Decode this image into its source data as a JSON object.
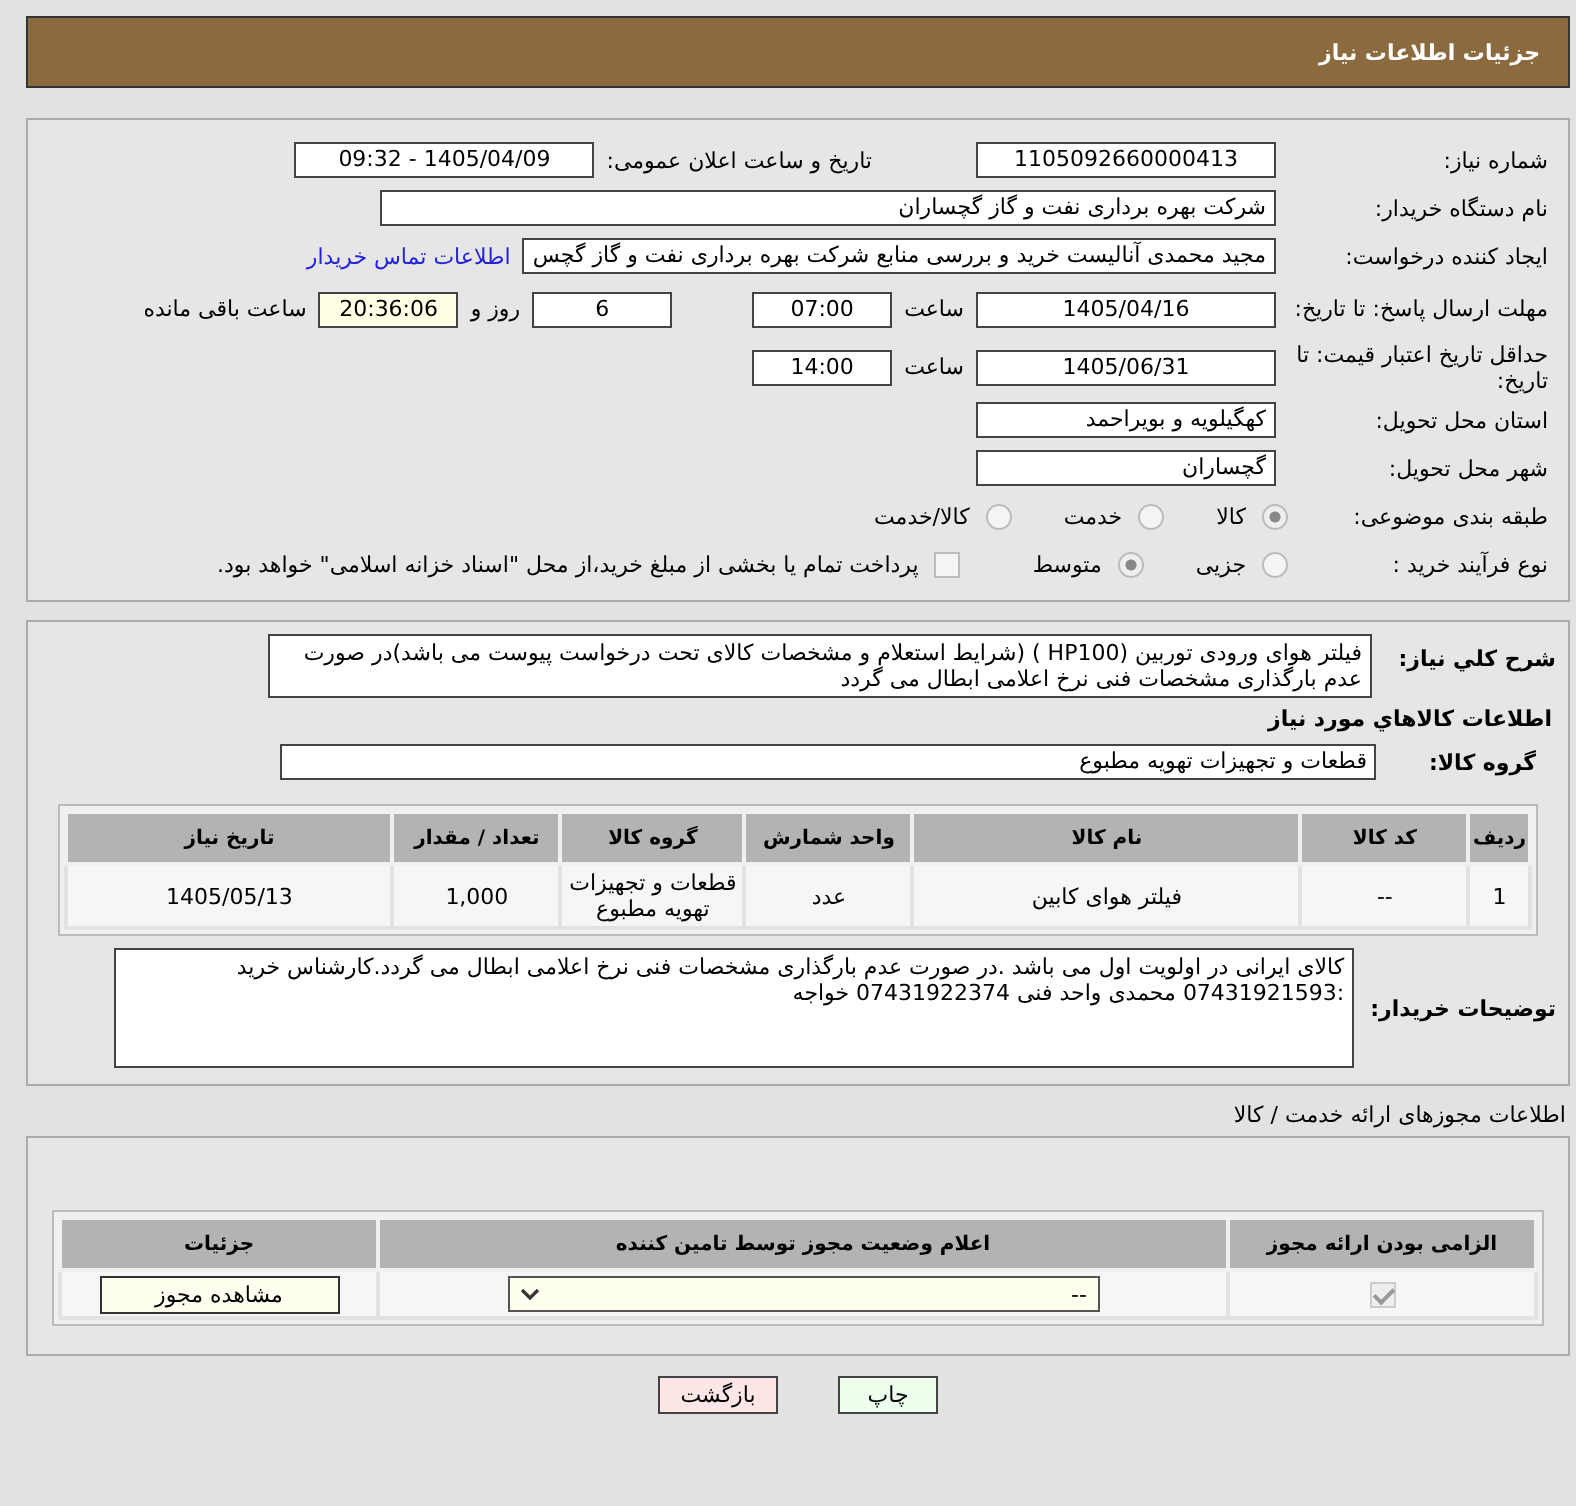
{
  "page_title": "جزئیات اطلاعات نیاز",
  "need_number": {
    "label": "شماره نیاز:",
    "value": "1105092660000413"
  },
  "announce": {
    "label": "تاریخ و ساعت اعلان عمومی:",
    "value": "1405/04/09 - 09:32"
  },
  "buyer_org": {
    "label": "نام دستگاه خریدار:",
    "value": "شرکت بهره برداری نفت و گاز گچساران"
  },
  "creator": {
    "label": "ایجاد کننده درخواست:",
    "value": "مجید محمدی آنالیست خرید و بررسی منابع شرکت بهره برداری نفت و گاز گچس",
    "link": "اطلاعات تماس خریدار"
  },
  "deadline": {
    "label": "مهلت ارسال پاسخ: تا تاریخ:",
    "date": "1405/04/16",
    "time_label": "ساعت",
    "time": "07:00",
    "days": "6",
    "days_label": "روز و",
    "remaining": "20:36:06",
    "remaining_label": "ساعت باقی مانده"
  },
  "validity": {
    "label": "حداقل تاریخ اعتبار قیمت: تا تاریخ:",
    "date": "1405/06/31",
    "time_label": "ساعت",
    "time": "14:00"
  },
  "province": {
    "label": "استان محل تحویل:",
    "value": "کهگیلویه و بویراحمد"
  },
  "city": {
    "label": "شهر محل تحویل:",
    "value": "گچساران"
  },
  "category": {
    "label": "طبقه بندی موضوعی:",
    "options": [
      {
        "label": "کالا",
        "selected": true
      },
      {
        "label": "خدمت",
        "selected": false
      },
      {
        "label": "کالا/خدمت",
        "selected": false
      }
    ]
  },
  "process": {
    "label": "نوع فرآیند خرید :",
    "options": [
      {
        "label": "جزیی",
        "selected": false
      },
      {
        "label": "متوسط",
        "selected": true
      }
    ],
    "payment": {
      "label": "پرداخت تمام یا بخشی از مبلغ خرید،از محل \"اسناد خزانه اسلامی\" خواهد بود.",
      "checked": false
    }
  },
  "description": {
    "label": "شرح کلي نياز:",
    "value": "فیلتر هوای ورودی توربین (HP100 ) (شرایط استعلام و مشخصات کالای تحت درخواست پیوست می باشد)در صورت عدم بارگذاری مشخصات فنی نرخ اعلامی ابطال می گردد"
  },
  "goods_title": "اطلاعات کالاهاي مورد نياز",
  "goods_group": {
    "label": "گروه کالا:",
    "value": "قطعات و تجهیزات تهویه مطبوع"
  },
  "goods_table": {
    "columns": [
      "ردیف",
      "کد کالا",
      "نام کالا",
      "واحد شمارش",
      "گروه کالا",
      "تعداد / مقدار",
      "تاریخ نیاز"
    ],
    "rows": [
      [
        "1",
        "--",
        "فیلتر هوای کابین",
        "عدد",
        "قطعات و تجهیزات تهویه مطبوع",
        "1,000",
        "1405/05/13"
      ]
    ]
  },
  "buyer_notes": {
    "label": "توضیحات خریدار:",
    "value": "کالای ایرانی در اولویت اول می باشد .در صورت عدم بارگذاری مشخصات فنی نرخ اعلامی ابطال می گردد.کارشناس خرید :07431921593 محمدی واحد فنی 07431922374  خواجه"
  },
  "license_title": "اطلاعات مجوزهای ارائه خدمت / کالا",
  "license_table": {
    "columns": [
      "الزامی بودن ارائه مجوز",
      "اعلام وضعیت مجوز توسط تامین کننده",
      "جزئیات"
    ],
    "rows": [
      {
        "required": true,
        "status": "--",
        "action": "مشاهده مجوز"
      }
    ]
  },
  "buttons": [
    {
      "label": "چاپ",
      "kind": "print"
    },
    {
      "label": "بازگشت",
      "kind": "back"
    }
  ]
}
